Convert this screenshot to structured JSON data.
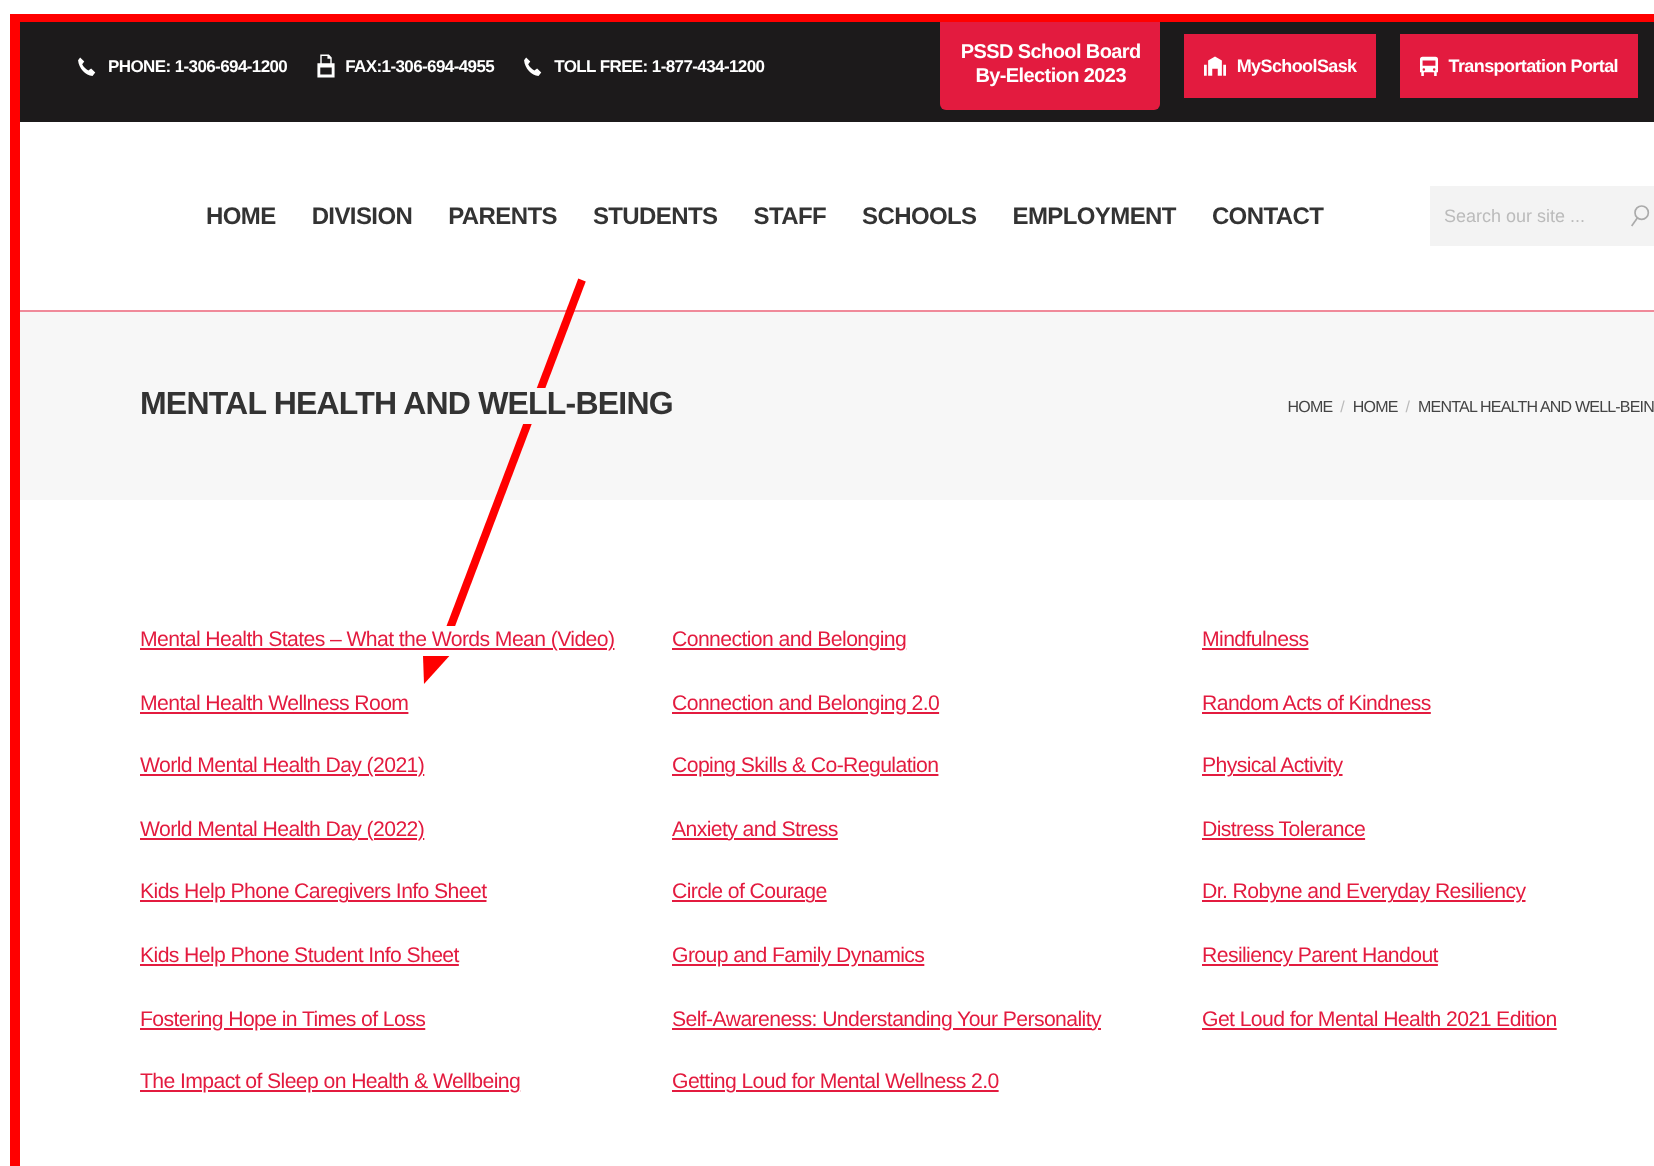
{
  "top_bar": {
    "phone": "PHONE: 1-306-694-1200",
    "fax": "FAX:1-306-694-4955",
    "toll_free": "TOLL FREE: 1-877-434-1200",
    "election_button": {
      "label": "PSSD School Board By-Election 2023"
    },
    "myschoolsask_button": {
      "label": "MySchoolSask"
    },
    "transportation_button": {
      "label": "Transportation Portal"
    }
  },
  "nav": {
    "items": [
      "HOME",
      "DIVISION",
      "PARENTS",
      "STUDENTS",
      "STAFF",
      "SCHOOLS",
      "EMPLOYMENT",
      "CONTACT"
    ],
    "search": {
      "placeholder": "Search our site ..."
    }
  },
  "page_header": {
    "title": "MENTAL HEALTH AND WELL-BEING",
    "breadcrumb": [
      {
        "kind": "link",
        "text": "HOME"
      },
      {
        "kind": "separator",
        "text": "/"
      },
      {
        "kind": "link",
        "text": "HOME"
      },
      {
        "kind": "separator",
        "text": "/"
      },
      {
        "kind": "link",
        "text": "MENTAL HEALTH AND WELL-BEIN"
      }
    ]
  },
  "link_columns": [
    [
      "Mental Health States – What the Words Mean (Video)",
      "Mental Health Wellness Room",
      "World Mental Health Day (2021)",
      "World Mental Health Day (2022)",
      "Kids Help Phone Caregivers Info Sheet",
      "Kids Help Phone Student Info Sheet",
      "Fostering Hope in Times of Loss",
      "The Impact of Sleep on Health & Wellbeing"
    ],
    [
      "Connection and Belonging",
      "Connection and Belonging 2.0",
      "Coping Skills & Co-Regulation",
      "Anxiety and Stress",
      "Circle of Courage",
      "Group and Family Dynamics",
      "Self-Awareness: Understanding Your Personality",
      "Getting Loud for Mental Wellness 2.0"
    ],
    [
      "Mindfulness",
      "Random Acts of Kindness",
      "Physical Activity",
      "Distress Tolerance",
      "Dr. Robyne and Everyday Resiliency",
      "Resiliency Parent Handout",
      "Get Loud for Mental Health 2021 Edition"
    ]
  ]
}
